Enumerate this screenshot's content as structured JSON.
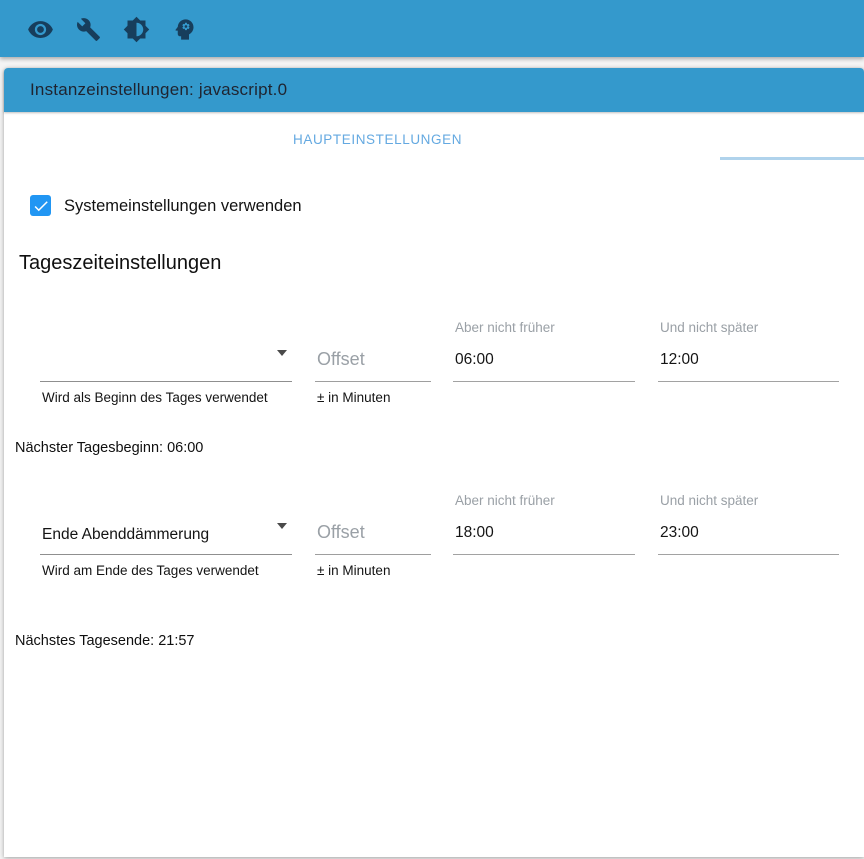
{
  "toolbar": {
    "icons": [
      {
        "name": "eye-icon"
      },
      {
        "name": "wrench-icon"
      },
      {
        "name": "brightness-icon"
      },
      {
        "name": "expert-mode-icon"
      }
    ]
  },
  "dialog": {
    "title": "Instanzeinstellungen: javascript.0"
  },
  "tabs": {
    "main_label": "HAUPTEINSTELLUNGEN"
  },
  "system_settings": {
    "label": "Systemeinstellungen verwenden",
    "checked": true
  },
  "section": {
    "title": "Tageszeiteinstellungen"
  },
  "day_start": {
    "select_value": "",
    "select_helper": "Wird als Beginn des Tages verwendet",
    "offset_placeholder": "Offset",
    "offset_value": "",
    "offset_helper": "± in Minuten",
    "not_earlier_label": "Aber nicht früher",
    "not_earlier_value": "06:00",
    "not_later_label": "Und nicht später",
    "not_later_value": "12:00"
  },
  "next_day_start": "Nächster Tagesbeginn: 06:00",
  "day_end": {
    "select_value": "Ende Abenddämmerung",
    "select_helper": "Wird am Ende des Tages verwendet",
    "offset_placeholder": "Offset",
    "offset_value": "",
    "offset_helper": "± in Minuten",
    "not_earlier_label": "Aber nicht früher",
    "not_earlier_value": "18:00",
    "not_later_label": "Und nicht später",
    "not_later_value": "23:00"
  },
  "next_day_end": "Nächstes Tagesende: 21:57",
  "colors": {
    "primary": "#3499cc",
    "toolbar_icon": "#173e5c",
    "header_text": "#1f2430",
    "tab_text": "#64a9e1",
    "tab_indicator": "#b0d3ec",
    "checkbox": "#2196f3",
    "text": "#141414",
    "muted": "#9aa0a6",
    "underline": "#8f8f8f"
  }
}
